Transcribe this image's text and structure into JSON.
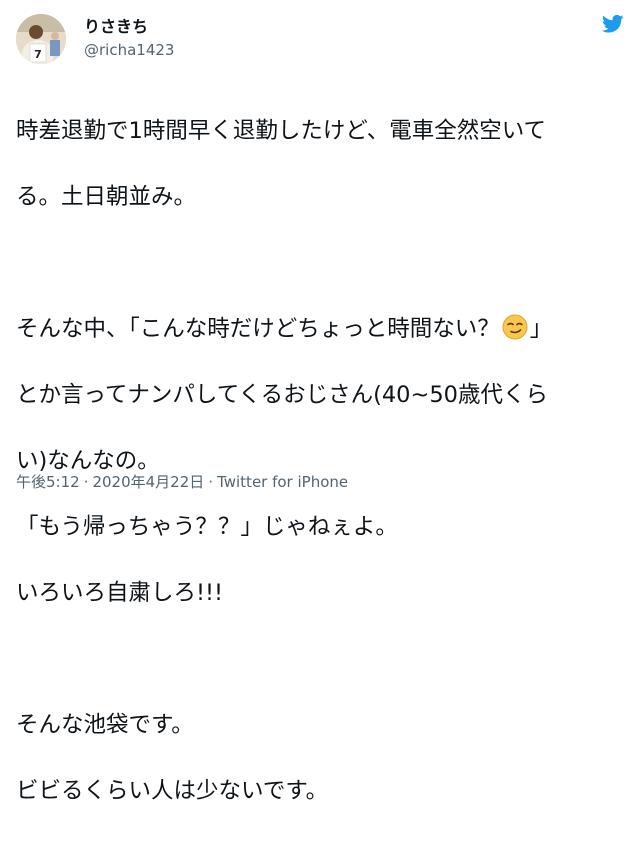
{
  "user": {
    "display_name": "りさきち",
    "handle": "@richa1423",
    "avatar_icon": "avatar-photo",
    "logo_icon": "twitter-bird-icon",
    "brand_color": "#1d9bf0"
  },
  "tweet": {
    "lines": [
      "時差退勤で1時間早く退勤したけど、電車全然空いて",
      "る。土日朝並み。",
      "",
      "そんな中、「こんな時だけどちょっと時間ない？",
      "とか言ってナンパしてくるおじさん(40~50歳代くら",
      "い)なんなの。",
      "「もう帰っちゃう？？」じゃねぇよ。",
      "いろいろ自粛しろ!!!",
      "",
      "そんな池袋です。",
      "ビビるくらい人は少ないです。"
    ],
    "line4_tail": "」",
    "emoji_icon": "smirking-face-emoji"
  },
  "meta": {
    "time": "午後5:12",
    "separator": "·",
    "date": "2020年4月22日",
    "source": "Twitter for iPhone"
  }
}
